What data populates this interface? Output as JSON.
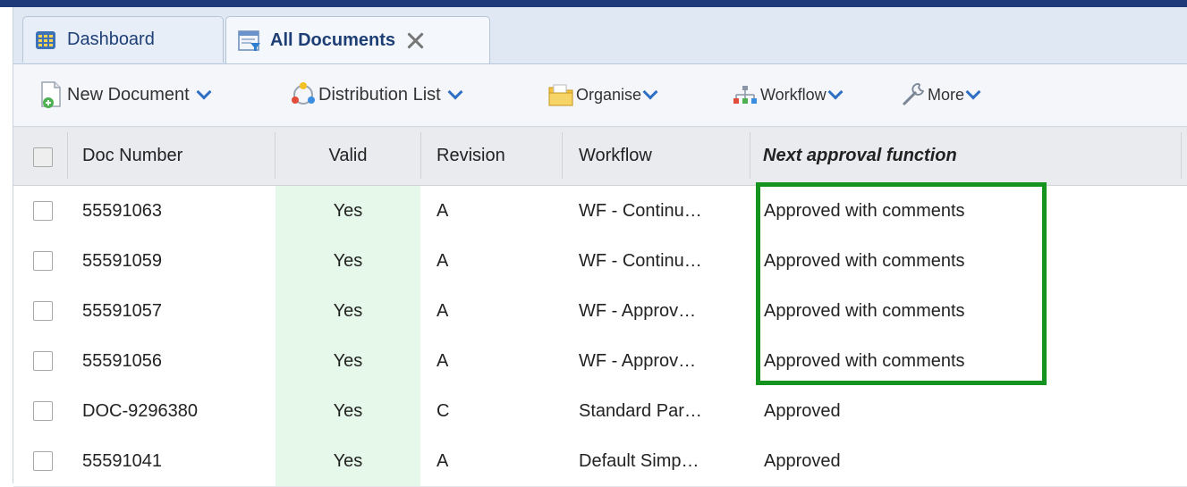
{
  "tabs": [
    {
      "label": "Dashboard",
      "icon": "dashboard-icon"
    },
    {
      "label": "All Documents",
      "icon": "documents-list-icon",
      "active": true
    }
  ],
  "toolbar": {
    "new_document": "New Document",
    "distribution_list": "Distribution List",
    "organise": "Organise",
    "workflow": "Workflow",
    "more": "More"
  },
  "columns": {
    "doc_number": "Doc Number",
    "valid": "Valid",
    "revision": "Revision",
    "workflow": "Workflow",
    "next_approval": "Next approval function"
  },
  "rows": [
    {
      "doc_number": "55591063",
      "valid": "Yes",
      "revision": "A",
      "workflow": "WF - Continu…",
      "next_approval": "Approved with comments"
    },
    {
      "doc_number": "55591059",
      "valid": "Yes",
      "revision": "A",
      "workflow": "WF - Continu…",
      "next_approval": "Approved with comments"
    },
    {
      "doc_number": "55591057",
      "valid": "Yes",
      "revision": "A",
      "workflow": "WF - Approv…",
      "next_approval": "Approved with comments"
    },
    {
      "doc_number": "55591056",
      "valid": "Yes",
      "revision": "A",
      "workflow": "WF - Approv…",
      "next_approval": "Approved with comments"
    },
    {
      "doc_number": "DOC-9296380",
      "valid": "Yes",
      "revision": "C",
      "workflow": "Standard Par…",
      "next_approval": "Approved"
    },
    {
      "doc_number": "55591041",
      "valid": "Yes",
      "revision": "A",
      "workflow": "Default Simp…",
      "next_approval": "Approved"
    }
  ],
  "colors": {
    "valid_cell_bg": "#e6f8ea",
    "highlight_border": "#14931e",
    "top_bar": "#1e3a78"
  }
}
